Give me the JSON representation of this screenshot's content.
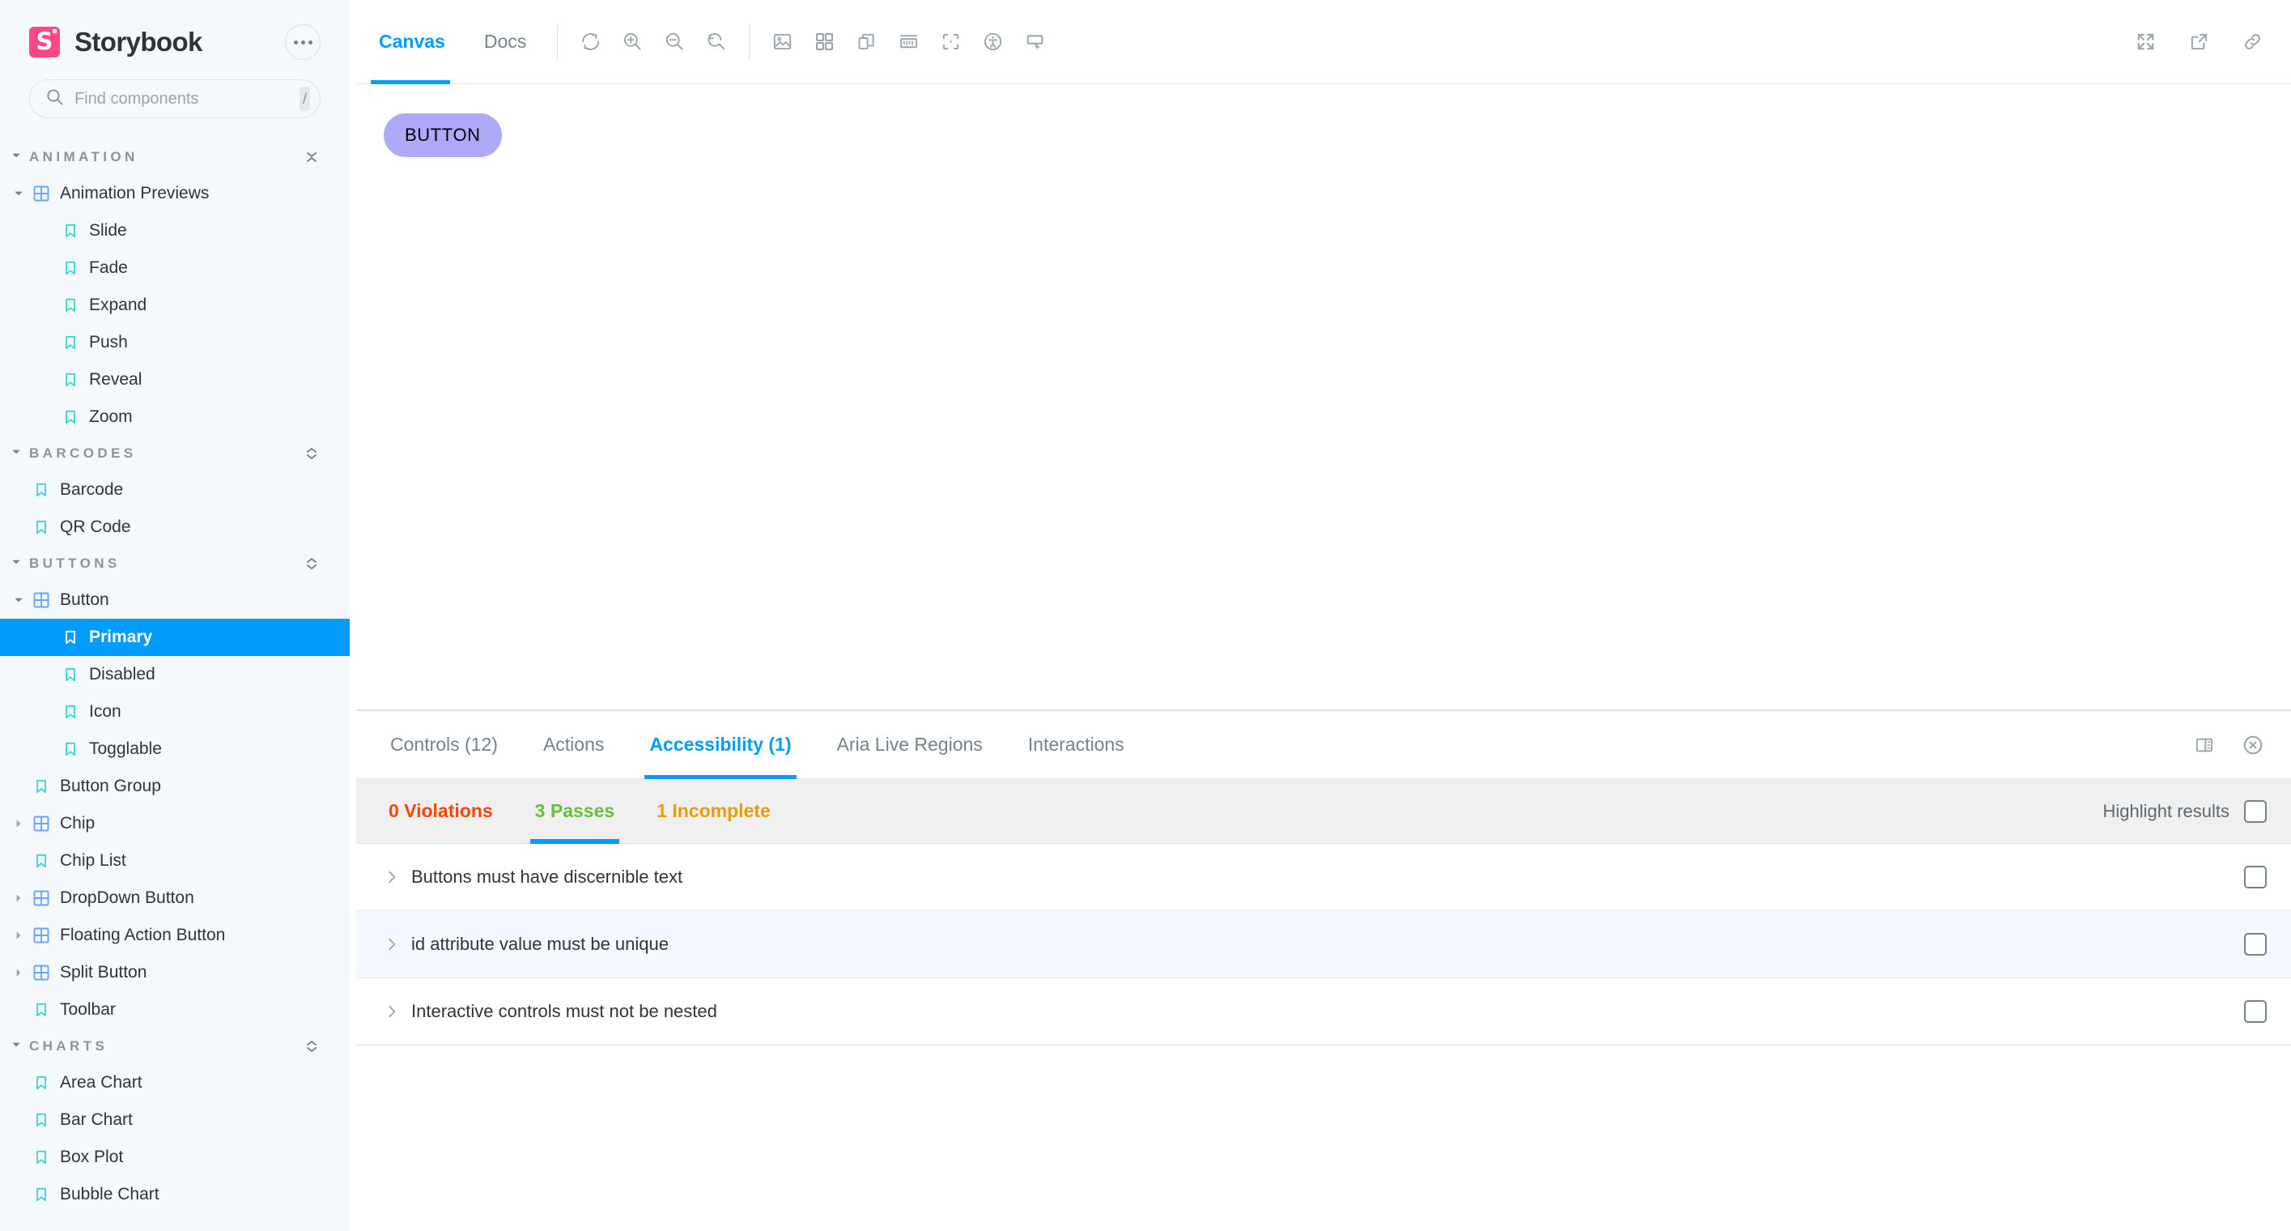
{
  "brand": {
    "name": "Storybook",
    "logo_letter": "S",
    "logo_color": "#FF4785",
    "menu_icon": "ellipsis-icon"
  },
  "search": {
    "placeholder": "Find components",
    "value": "",
    "shortcut": "/",
    "icon": "search-icon"
  },
  "accent_color": "#029CFD",
  "sidebar": {
    "sections": [
      {
        "title": "ANIMATION",
        "expanded": true,
        "toggle_icon": "collapse-all-icon",
        "nodes": [
          {
            "label": "Animation Previews",
            "type": "component",
            "depth": 1,
            "expanded": true,
            "selected": false
          },
          {
            "label": "Slide",
            "type": "story",
            "depth": 2,
            "selected": false
          },
          {
            "label": "Fade",
            "type": "story",
            "depth": 2,
            "selected": false
          },
          {
            "label": "Expand",
            "type": "story",
            "depth": 2,
            "selected": false
          },
          {
            "label": "Push",
            "type": "story",
            "depth": 2,
            "selected": false
          },
          {
            "label": "Reveal",
            "type": "story",
            "depth": 2,
            "selected": false
          },
          {
            "label": "Zoom",
            "type": "story",
            "depth": 2,
            "selected": false
          }
        ]
      },
      {
        "title": "BARCODES",
        "expanded": true,
        "toggle_icon": "expand-all-icon",
        "nodes": [
          {
            "label": "Barcode",
            "type": "story",
            "depth": 1,
            "selected": false
          },
          {
            "label": "QR Code",
            "type": "story",
            "depth": 1,
            "selected": false
          }
        ]
      },
      {
        "title": "BUTTONS",
        "expanded": true,
        "toggle_icon": "expand-all-icon",
        "nodes": [
          {
            "label": "Button",
            "type": "component",
            "depth": 1,
            "expanded": true,
            "selected": false
          },
          {
            "label": "Primary",
            "type": "story",
            "depth": 2,
            "selected": true
          },
          {
            "label": "Disabled",
            "type": "story",
            "depth": 2,
            "selected": false
          },
          {
            "label": "Icon",
            "type": "story",
            "depth": 2,
            "selected": false
          },
          {
            "label": "Togglable",
            "type": "story",
            "depth": 2,
            "selected": false
          },
          {
            "label": "Button Group",
            "type": "story",
            "depth": 1,
            "selected": false
          },
          {
            "label": "Chip",
            "type": "component",
            "depth": 1,
            "expanded": false,
            "selected": false
          },
          {
            "label": "Chip List",
            "type": "story",
            "depth": 1,
            "selected": false
          },
          {
            "label": "DropDown Button",
            "type": "component",
            "depth": 1,
            "expanded": false,
            "selected": false
          },
          {
            "label": "Floating Action Button",
            "type": "component",
            "depth": 1,
            "expanded": false,
            "selected": false
          },
          {
            "label": "Split Button",
            "type": "component",
            "depth": 1,
            "expanded": false,
            "selected": false
          },
          {
            "label": "Toolbar",
            "type": "story",
            "depth": 1,
            "selected": false
          }
        ]
      },
      {
        "title": "CHARTS",
        "expanded": true,
        "toggle_icon": "expand-all-icon",
        "nodes": [
          {
            "label": "Area Chart",
            "type": "story",
            "depth": 1,
            "selected": false
          },
          {
            "label": "Bar Chart",
            "type": "story",
            "depth": 1,
            "selected": false
          },
          {
            "label": "Box Plot",
            "type": "story",
            "depth": 1,
            "selected": false
          },
          {
            "label": "Bubble Chart",
            "type": "story",
            "depth": 1,
            "selected": false
          }
        ]
      }
    ]
  },
  "toolbar": {
    "tabs": [
      {
        "label": "Canvas",
        "active": true
      },
      {
        "label": "Docs",
        "active": false
      }
    ],
    "tools": [
      {
        "name": "remount-icon",
        "title": "Remount component"
      },
      {
        "name": "zoom-in-icon",
        "title": "Zoom in"
      },
      {
        "name": "zoom-out-icon",
        "title": "Zoom out"
      },
      {
        "name": "zoom-reset-icon",
        "title": "Reset zoom"
      },
      {
        "name": "backgrounds-icon",
        "title": "Change background"
      },
      {
        "name": "grid-icon",
        "title": "Apply a grid to the preview"
      },
      {
        "name": "viewport-icon",
        "title": "Change the size of the preview"
      },
      {
        "name": "measure-icon",
        "title": "Enable measure"
      },
      {
        "name": "outline-icon",
        "title": "Apply outlines to the preview"
      },
      {
        "name": "accessibility-icon",
        "title": "Accessibility"
      },
      {
        "name": "pointer-icon",
        "title": "Interactions"
      }
    ],
    "right_tools": [
      {
        "name": "fullscreen-icon",
        "title": "Go full screen"
      },
      {
        "name": "open-new-tab-icon",
        "title": "Open canvas in new tab"
      },
      {
        "name": "copy-link-icon",
        "title": "Copy canvas link"
      }
    ]
  },
  "canvas": {
    "button_label": "BUTTON",
    "button_color": "#AFAAF7",
    "button_text_color": "#000000"
  },
  "panel": {
    "tabs": [
      {
        "label": "Controls (12)",
        "active": false
      },
      {
        "label": "Actions",
        "active": false
      },
      {
        "label": "Accessibility (1)",
        "active": true
      },
      {
        "label": "Aria Live Regions",
        "active": false
      },
      {
        "label": "Interactions",
        "active": false
      }
    ],
    "right_icons": [
      {
        "name": "panel-position-icon",
        "title": "Change addon orientation"
      },
      {
        "name": "close-panel-icon",
        "title": "Hide addons"
      }
    ]
  },
  "a11y": {
    "status_tabs": [
      {
        "label": "0 Violations",
        "color": "#FF4400",
        "active": false
      },
      {
        "label": "3 Passes",
        "color": "#66BF3C",
        "active": true
      },
      {
        "label": "1 Incomplete",
        "color": "#E69D00",
        "active": false
      }
    ],
    "highlight_label": "Highlight results",
    "highlight_checked": false,
    "results": [
      {
        "title": "Buttons must have discernible text",
        "checked": false,
        "alt": false
      },
      {
        "title": "id attribute value must be unique",
        "checked": false,
        "alt": true
      },
      {
        "title": "Interactive controls must not be nested",
        "checked": false,
        "alt": false
      }
    ]
  }
}
